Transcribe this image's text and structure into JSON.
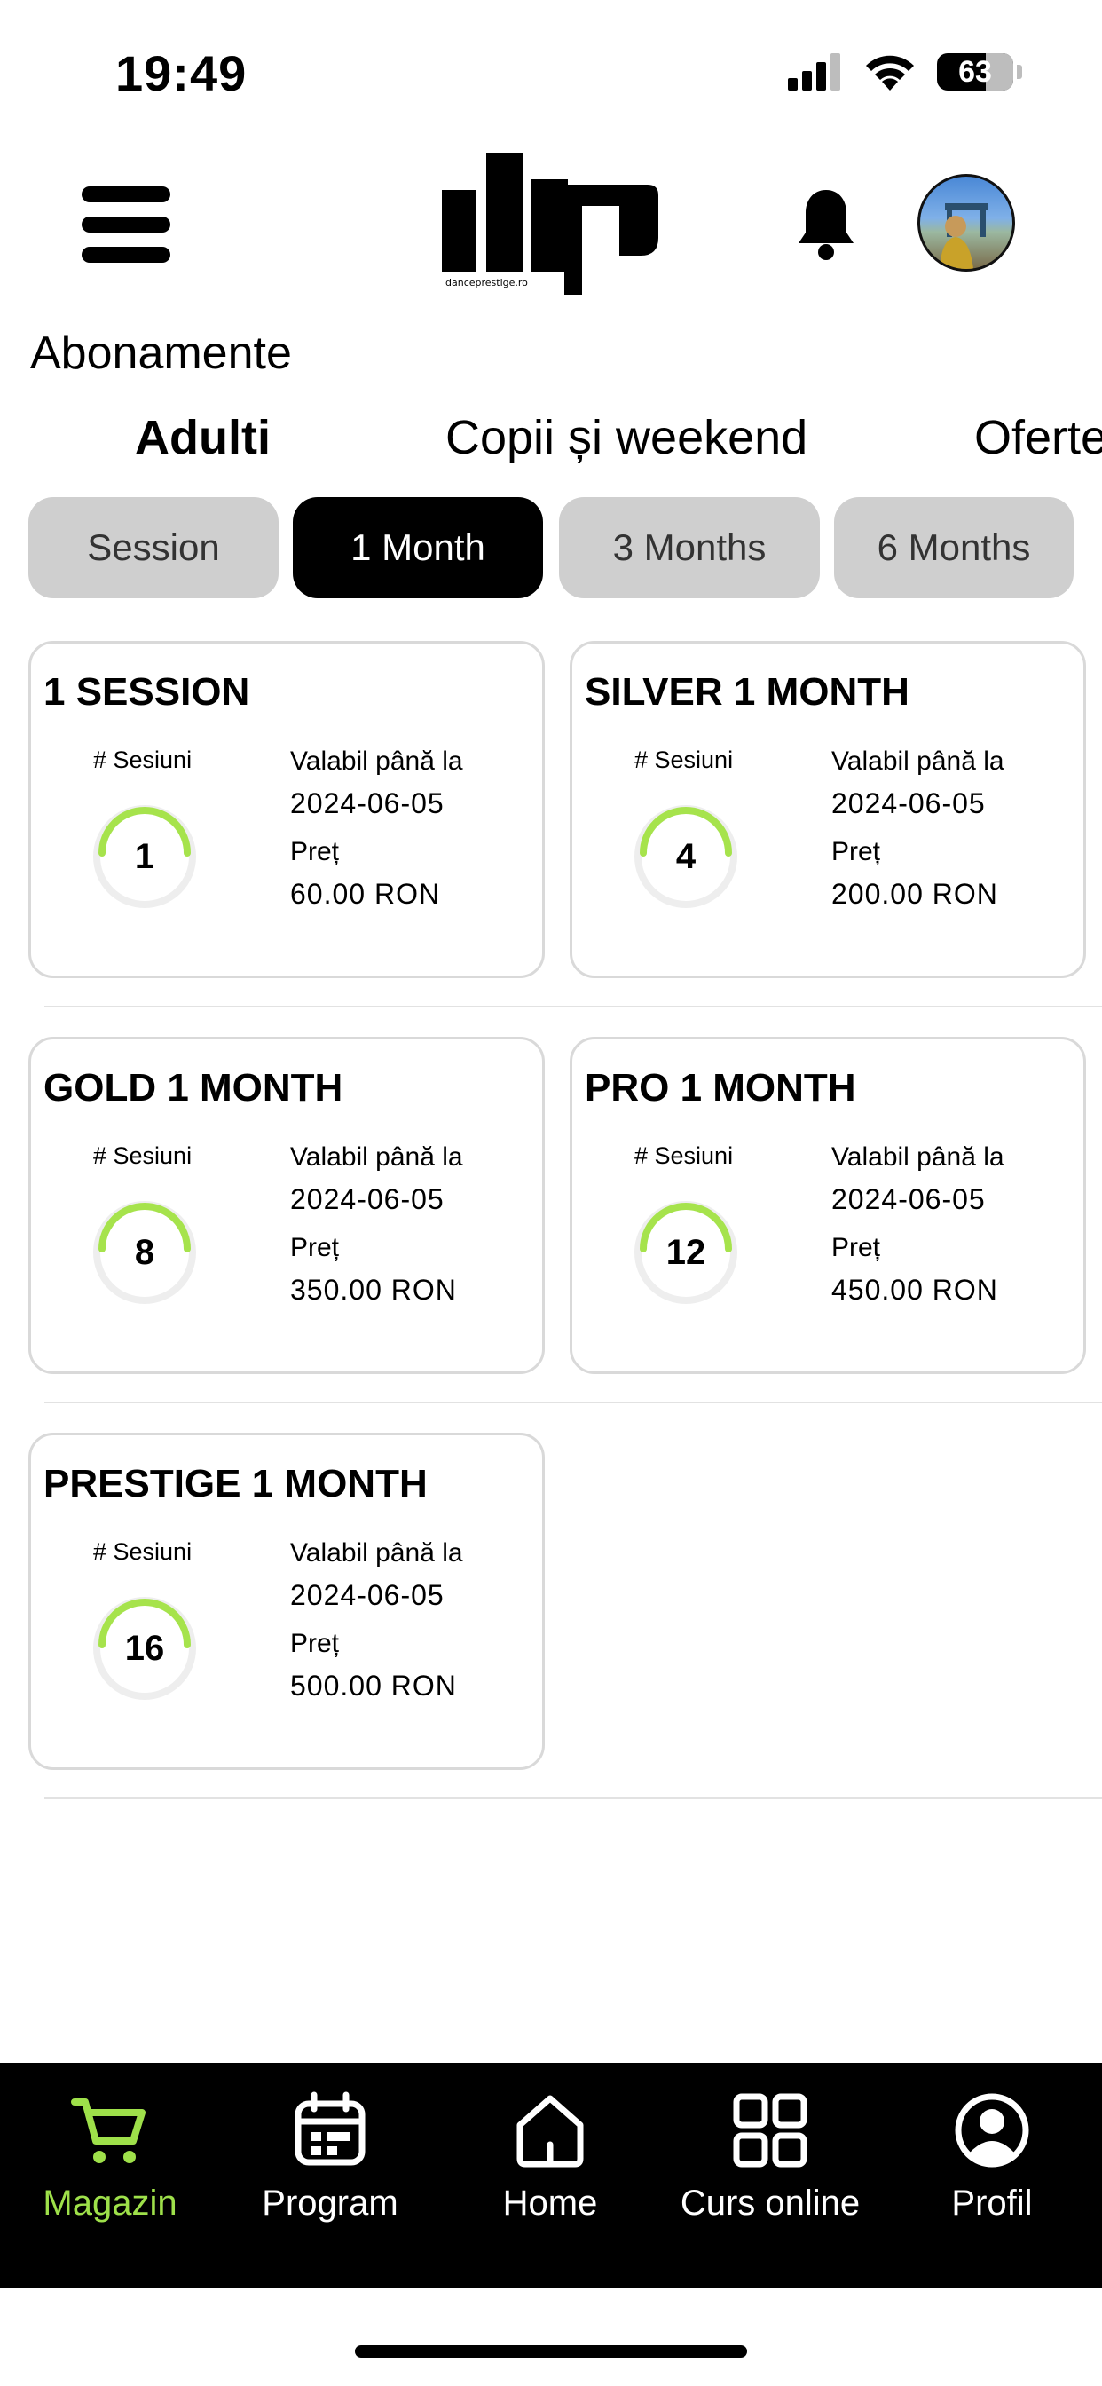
{
  "status_bar": {
    "time": "19:49",
    "battery": "63"
  },
  "header": {
    "logo_text": "danceprestige.ro"
  },
  "page": {
    "title": "Abonamente"
  },
  "category_tabs": [
    "Adulti",
    "Copii și weekend",
    "Oferte"
  ],
  "period_tabs": [
    "Session",
    "1 Month",
    "3 Months",
    "6 Months"
  ],
  "cards": [
    {
      "title": "1 SESSION",
      "sessions_label": "# Sesiuni",
      "sessions": "1",
      "valid_label": "Valabil până la",
      "valid_until": "2024-06-05",
      "price_label": "Preț",
      "price": "60.00 RON"
    },
    {
      "title": "SILVER 1 MONTH",
      "sessions_label": "# Sesiuni",
      "sessions": "4",
      "valid_label": "Valabil până la",
      "valid_until": "2024-06-05",
      "price_label": "Preț",
      "price": "200.00 RON"
    },
    {
      "title": "GOLD 1 MONTH",
      "sessions_label": "# Sesiuni",
      "sessions": "8",
      "valid_label": "Valabil până la",
      "valid_until": "2024-06-05",
      "price_label": "Preț",
      "price": "350.00 RON"
    },
    {
      "title": "PRO 1 MONTH",
      "sessions_label": "# Sesiuni",
      "sessions": "12",
      "valid_label": "Valabil până la",
      "valid_until": "2024-06-05",
      "price_label": "Preț",
      "price": "450.00 RON"
    },
    {
      "title": "PRESTIGE 1 MONTH",
      "sessions_label": "# Sesiuni",
      "sessions": "16",
      "valid_label": "Valabil până la",
      "valid_until": "2024-06-05",
      "price_label": "Preț",
      "price": "500.00 RON"
    }
  ],
  "bottom_nav": [
    {
      "label": "Magazin",
      "icon": "cart-icon"
    },
    {
      "label": "Program",
      "icon": "calendar-icon"
    },
    {
      "label": "Home",
      "icon": "home-icon"
    },
    {
      "label": "Curs online",
      "icon": "grid-icon"
    },
    {
      "label": "Profil",
      "icon": "user-icon"
    }
  ],
  "colors": {
    "accent": "#9ee04a",
    "pill_inactive": "#cfcfcf",
    "pill_active": "#000000",
    "card_border": "#d9d9d9"
  }
}
